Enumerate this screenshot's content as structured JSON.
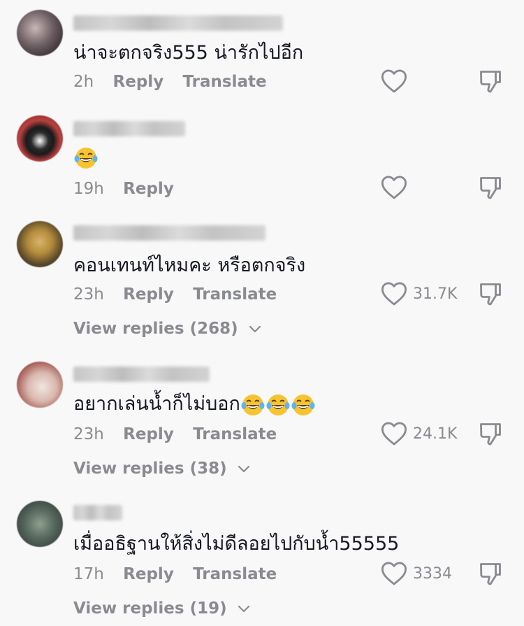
{
  "comments": [
    {
      "text": "น่าจะตกจริง555 น่ารักไปอีก",
      "time": "2h",
      "reply_label": "Reply",
      "translate_label": "Translate",
      "likes": "",
      "view_replies": ""
    },
    {
      "text": "",
      "time": "19h",
      "reply_label": "Reply",
      "translate_label": "",
      "likes": "",
      "view_replies": ""
    },
    {
      "text": "คอนเทนท์ไหมคะ หรือตกจริง",
      "time": "23h",
      "reply_label": "Reply",
      "translate_label": "Translate",
      "likes": "31.7K",
      "view_replies": "View replies (268)"
    },
    {
      "text": "อยากเล่นน้ำก็ไม่บอก",
      "time": "23h",
      "reply_label": "Reply",
      "translate_label": "Translate",
      "likes": "24.1K",
      "view_replies": "View replies (38)"
    },
    {
      "text": "เมื่ออธิฐานให้สิ่งไม่ดีลอยไปกับน้ำ55555",
      "time": "17h",
      "reply_label": "Reply",
      "translate_label": "Translate",
      "likes": "3334",
      "view_replies": "View replies (19)"
    }
  ],
  "icons": {
    "like": "heart-outline-icon",
    "dislike": "thumbs-down-outline-icon",
    "emoji": "tears-of-joy-emoji",
    "chevron": "chevron-down-icon"
  },
  "colors": {
    "background": "#f8f8f8",
    "text": "#161823",
    "secondary": "#8a8b91",
    "emoji_face": "#f7c431"
  }
}
